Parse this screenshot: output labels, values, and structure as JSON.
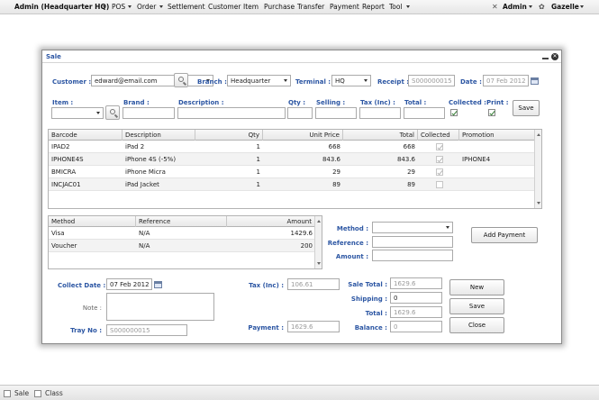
{
  "menubar": {
    "brand": "Admin (Headquarter HQ)",
    "items": [
      "POS",
      "Order",
      "Settlement",
      "Customer",
      "Item",
      "Purchase",
      "Transfer",
      "Payment",
      "Report",
      "Tool"
    ],
    "user": "Admin",
    "theme": "Gazelle"
  },
  "dialog": {
    "title": "Sale",
    "header": {
      "customer_label": "Customer :",
      "customer_value": "edward@email.com",
      "branch_label": "Branch :",
      "branch_value": "Headquarter",
      "terminal_label": "Terminal :",
      "terminal_value": "HQ",
      "receipt_label": "Receipt :",
      "receipt_value": "S000000015",
      "date_label": "Date :",
      "date_value": "07 Feb 2012"
    },
    "item_entry": {
      "item_label": "Item :",
      "brand_label": "Brand :",
      "description_label": "Description :",
      "qty_label": "Qty :",
      "selling_label": "Selling :",
      "tax_label": "Tax (Inc) :",
      "total_label": "Total :",
      "collected_label": "Collected :",
      "print_label": "Print :",
      "save_label": "Save"
    },
    "items_grid": {
      "columns": [
        "Barcode",
        "Description",
        "Qty",
        "Unit Price",
        "Total",
        "Collected",
        "Promotion"
      ],
      "rows": [
        {
          "barcode": "IPAD2",
          "description": "iPad 2",
          "qty": "1",
          "unit_price": "668",
          "total": "668",
          "collected": true,
          "promotion": ""
        },
        {
          "barcode": "IPHONE4S",
          "description": "iPhone 4S (-5%)",
          "qty": "1",
          "unit_price": "843.6",
          "total": "843.6",
          "collected": true,
          "promotion": "IPHONE4"
        },
        {
          "barcode": "BMICRA",
          "description": "iPhone Micra",
          "qty": "1",
          "unit_price": "29",
          "total": "29",
          "collected": true,
          "promotion": ""
        },
        {
          "barcode": "INCJAC01",
          "description": "iPad Jacket",
          "qty": "1",
          "unit_price": "89",
          "total": "89",
          "collected": false,
          "promotion": ""
        }
      ]
    },
    "payment_grid": {
      "columns": [
        "Method",
        "Reference",
        "Amount"
      ],
      "rows": [
        {
          "method": "Visa",
          "reference": "N/A",
          "amount": "1429.6"
        },
        {
          "method": "Voucher",
          "reference": "N/A",
          "amount": "200"
        }
      ]
    },
    "payment_entry": {
      "method_label": "Method :",
      "reference_label": "Reference :",
      "amount_label": "Amount :",
      "add_payment_label": "Add Payment"
    },
    "footer": {
      "collect_date_label": "Collect Date :",
      "collect_date_value": "07 Feb 2012",
      "note_label": "Note :",
      "tray_label": "Tray No :",
      "tray_value": "S000000015",
      "tax_label": "Tax (Inc) :",
      "tax_value": "106.61",
      "payment_label": "Payment :",
      "payment_value": "1629.6",
      "sale_total_label": "Sale Total :",
      "sale_total_value": "1629.6",
      "shipping_label": "Shipping :",
      "shipping_value": "0",
      "total_label": "Total :",
      "total_value": "1629.6",
      "balance_label": "Balance :",
      "balance_value": "0",
      "new_label": "New",
      "save_label": "Save",
      "close_label": "Close"
    }
  },
  "statusbar": {
    "items": [
      "Sale",
      "Class"
    ]
  }
}
